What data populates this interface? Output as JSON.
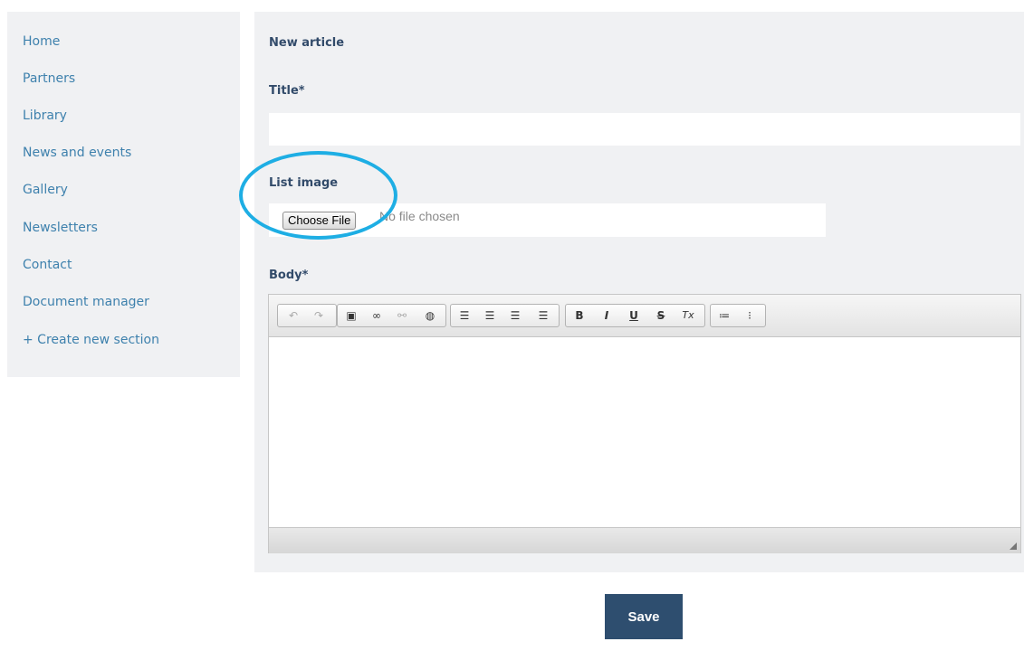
{
  "sidebar": {
    "items": [
      {
        "label": "Home"
      },
      {
        "label": "Partners"
      },
      {
        "label": "Library"
      },
      {
        "label": "News and events"
      },
      {
        "label": "Gallery"
      },
      {
        "label": "Newsletters"
      },
      {
        "label": "Contact"
      },
      {
        "label": "Document manager"
      },
      {
        "label": "+ Create new section"
      }
    ]
  },
  "form": {
    "heading": "New article",
    "title_label": "Title*",
    "title_value": "",
    "list_image_label": "List image",
    "choose_file_label": "Choose File",
    "no_file_text": "No file chosen",
    "body_label": "Body*",
    "body_value": ""
  },
  "toolbar": {
    "buttons": [
      {
        "icon": "undo-icon",
        "glyph": "↶"
      },
      {
        "icon": "redo-icon",
        "glyph": "↷"
      },
      {
        "icon": "image-icon",
        "glyph": "▣"
      },
      {
        "icon": "link-icon",
        "glyph": "∞"
      },
      {
        "icon": "unlink-icon",
        "glyph": "⚯"
      },
      {
        "icon": "anchor-icon",
        "glyph": "◍"
      },
      {
        "icon": "align-left-icon",
        "glyph": "☰"
      },
      {
        "icon": "align-center-icon",
        "glyph": "☰"
      },
      {
        "icon": "align-right-icon",
        "glyph": "☰"
      },
      {
        "icon": "align-justify-icon",
        "glyph": "☰"
      },
      {
        "icon": "bold-icon",
        "glyph": "B"
      },
      {
        "icon": "italic-icon",
        "glyph": "I"
      },
      {
        "icon": "underline-icon",
        "glyph": "U"
      },
      {
        "icon": "strikethrough-icon",
        "glyph": "S"
      },
      {
        "icon": "remove-format-icon",
        "glyph": "Tx"
      },
      {
        "icon": "numbered-list-icon",
        "glyph": "≔"
      },
      {
        "icon": "bulleted-list-icon",
        "glyph": "⁝"
      }
    ]
  },
  "actions": {
    "save_label": "Save"
  },
  "colors": {
    "link": "#3e81ad",
    "heading": "#324b6a",
    "panel_bg": "#f0f1f3",
    "callout": "#1eaee4",
    "save_bg": "#2e4e6f"
  }
}
